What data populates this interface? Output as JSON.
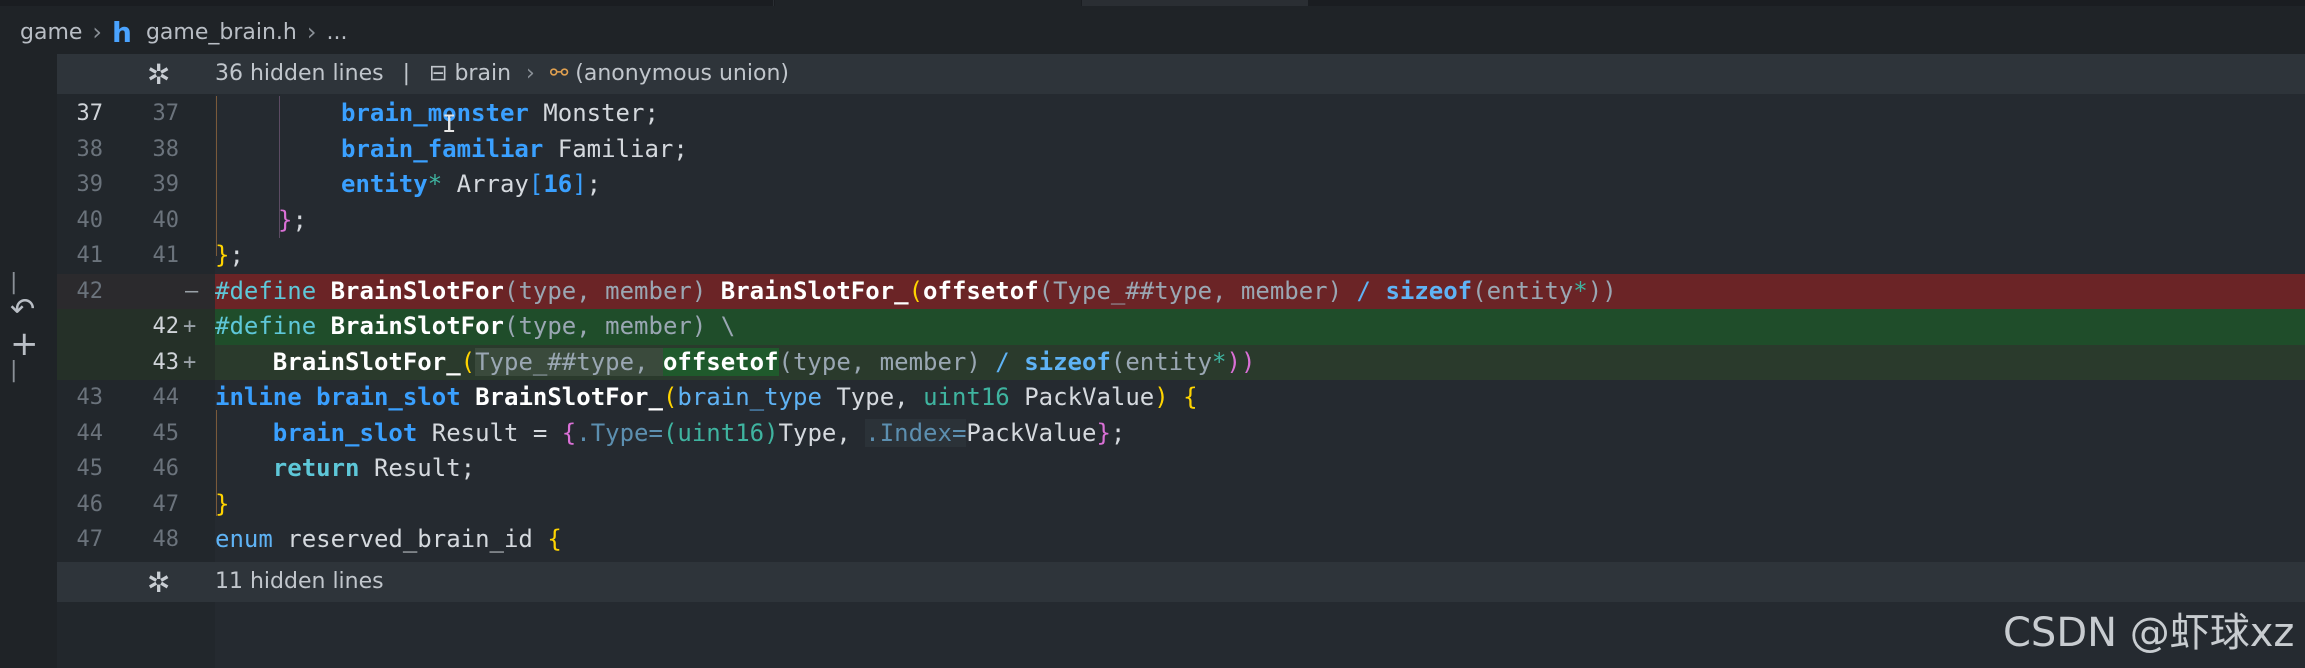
{
  "breadcrumb": {
    "folder": "game",
    "file": "game_brain.h",
    "more": "..."
  },
  "hidden_top": {
    "count_label": "36 hidden lines",
    "sep": "|",
    "symbol1": "brain",
    "symbol2": "(anonymous union)"
  },
  "hidden_bottom": {
    "count_label": "11 hidden lines"
  },
  "lines": [
    {
      "old": "37",
      "new": "37"
    },
    {
      "old": "38",
      "new": "38"
    },
    {
      "old": "39",
      "new": "39"
    },
    {
      "old": "40",
      "new": "40"
    },
    {
      "old": "41",
      "new": "41"
    },
    {
      "old": "42",
      "new": "",
      "marker": "—"
    },
    {
      "old": "",
      "new": "42",
      "marker": "+"
    },
    {
      "old": "",
      "new": "43",
      "marker": "+"
    },
    {
      "old": "43",
      "new": "44"
    },
    {
      "old": "44",
      "new": "45"
    },
    {
      "old": "45",
      "new": "46"
    },
    {
      "old": "46",
      "new": "47"
    },
    {
      "old": "47",
      "new": "48"
    }
  ],
  "code": {
    "l37": {
      "type": "brain_monster",
      "rest": " Monster;"
    },
    "l38": {
      "type": "brain_familiar",
      "rest": " Familiar;"
    },
    "l39": {
      "type": "entity",
      "star": "*",
      "name": " Array",
      "lb": "[",
      "num": "16",
      "rb": "]",
      "end": ";"
    },
    "l40": {
      "brace": "}",
      "end": ";"
    },
    "l41": {
      "brace": "}",
      "end": ";"
    },
    "l42_del": {
      "define": "#define",
      "sp": " ",
      "name": "BrainSlotFor",
      "params": "(type, member) ",
      "fn": "BrainSlotFor_",
      "lp": "(",
      "offsetof": "offsetof",
      "args": "(Type_##type, member) ",
      "slash": "/",
      "sp2": " ",
      "sizeof": "sizeof",
      "sarg": "(entity",
      "star": "*",
      "close": "))"
    },
    "l42_add": {
      "define": "#define",
      "sp": " ",
      "name": "BrainSlotFor",
      "params": "(type, member) ",
      "bs": "\\"
    },
    "l43_add": {
      "indent": "    ",
      "fn": "BrainSlotFor_",
      "lp": "(",
      "arg1": "Type_##type, ",
      "offsetof": "offsetof",
      "args": "(type, member) ",
      "slash": "/",
      "sp2": " ",
      "sizeof": "sizeof",
      "sarg": "(entity",
      "star": "*",
      "close": "))"
    },
    "l44": {
      "inline": "inline",
      "sp": " ",
      "type": "brain_slot",
      "sp2": " ",
      "fn": "BrainSlotFor_",
      "lp": "(",
      "t1": "brain_type",
      "a1": " Type, ",
      "t2": "uint16",
      "a2": " PackValue",
      "rp": ")",
      "sp3": " ",
      "lb": "{"
    },
    "l45": {
      "indent": "    ",
      "type": "brain_slot",
      "a": " Result = ",
      "lb": "{",
      "f1": ".Type=",
      "cast": "(uint16)",
      "a2": "Type, ",
      "f2": ".Index=",
      "a3": "PackValue",
      "rb": "}",
      "end": ";"
    },
    "l46": {
      "indent": "    ",
      "kw": "return",
      "rest": " Result;"
    },
    "l47": {
      "rb": "}"
    },
    "l48": {
      "kw": "enum",
      "rest": " reserved_brain_id ",
      "lb": "{"
    }
  },
  "watermark": "CSDN @虾球xz",
  "colors": {
    "deleted_line": "#6b2426",
    "added_line": "#1f4d2a",
    "type_blue": "#3aa0ff",
    "editor_bg": "#252a30"
  }
}
